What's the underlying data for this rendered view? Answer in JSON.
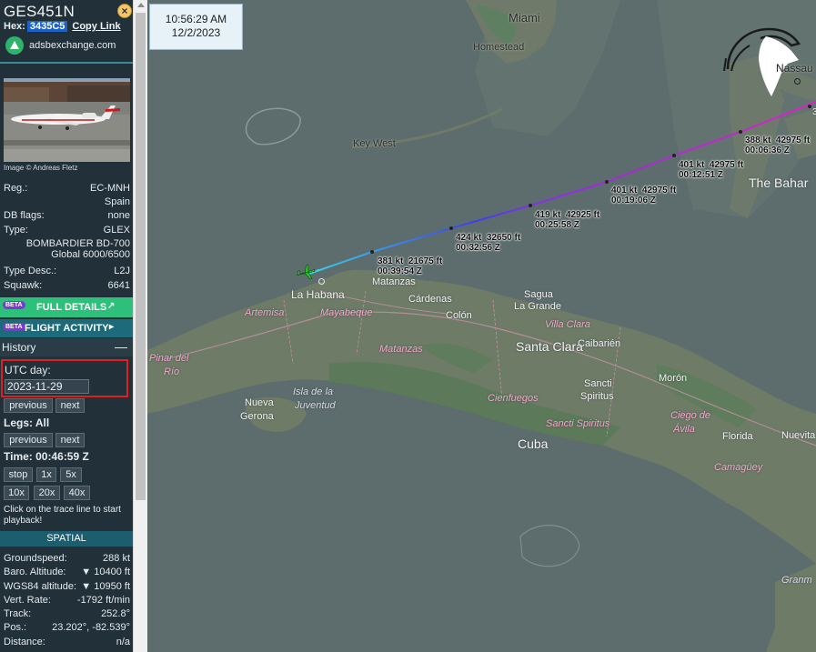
{
  "aircraft": {
    "callsign": "GES451N",
    "hex_label": "Hex:",
    "hex": "3435C5",
    "copy_link": "Copy Link",
    "brand": "adsbexchange.com",
    "image_credit": "Image © Andreas Fletz"
  },
  "details": {
    "reg_label": "Reg.:",
    "reg": "EC-MNH",
    "country": "Spain",
    "dbflags_label": "DB flags:",
    "dbflags": "none",
    "type_label": "Type:",
    "type": "GLEX",
    "model_line1": "BOMBARDIER BD-700",
    "model_line2": "Global 6000/6500",
    "typedesc_label": "Type Desc.:",
    "typedesc": "L2J",
    "squawk_label": "Squawk:",
    "squawk": "6641"
  },
  "buttons": {
    "beta": "BETA",
    "full_details": "FULL DETAILS",
    "flight_activity": "FLIGHT ACTIVITY"
  },
  "history": {
    "title": "History",
    "collapse": "—",
    "utc_label": "UTC day:",
    "utc_value": "2023-11-29",
    "previous": "previous",
    "next": "next",
    "legs_label": "Legs: All",
    "time_label": "Time: 00:46:59 Z",
    "stop": "stop",
    "s1x": "1x",
    "s5x": "5x",
    "s10x": "10x",
    "s20x": "20x",
    "s40x": "40x",
    "hint": "Click on the trace line to start playback!"
  },
  "spatial": {
    "title": "SPATIAL",
    "groundspeed_label": "Groundspeed:",
    "groundspeed": "288 kt",
    "baro_label": "Baro. Altitude:",
    "baro": "▼ 10400 ft",
    "wgs_label": "WGS84 altitude:",
    "wgs": "▼ 10950 ft",
    "vrate_label": "Vert. Rate:",
    "vrate": "-1792 ft/min",
    "track_label": "Track:",
    "track": "252.8°",
    "pos_label": "Pos.:",
    "pos": "23.202°, -82.539°",
    "distance_label": "Distance:",
    "distance": "n/a"
  },
  "clock": {
    "time": "10:56:29 AM",
    "date": "12/2/2023"
  },
  "map": {
    "labels": {
      "miami": "Miami",
      "homestead": "Homestead",
      "key_west": "Key West",
      "nassau": "Nassau",
      "bahamas": "The Bahar",
      "la_habana": "La Habana",
      "matanzas_city": "Matanzas",
      "cardenas": "Cárdenas",
      "sagua": "Sagua",
      "la_grande": "La Grande",
      "colon": "Colón",
      "villa_clara": "Villa Clara",
      "santa_clara": "Santa Clara",
      "caibarien": "Caibarién",
      "artemisa": "Artemisa",
      "mayabeque": "Mayabeque",
      "pinar1": "Pinar del",
      "pinar2": "Río",
      "matanzas_prov": "Matanzas",
      "moron": "Morón",
      "isla1": "Isla de la",
      "isla2": "Juventud",
      "nueva1": "Nueva",
      "nueva2": "Gerona",
      "cienfuegos": "Cienfuegos",
      "sancti1": "Sancti",
      "sancti2": "Spiritus",
      "sancti_prov": "Sancti Spiritus",
      "ciego1": "Ciego de",
      "ciego2": "Ávila",
      "florida": "Florida",
      "cuba": "Cuba",
      "camaguey": "Camagüey",
      "nuevita": "Nuevita",
      "granm": "Granm",
      "edge": "3"
    },
    "track_points": [
      {
        "speed": "381 kt",
        "alt": "21675 ft",
        "time": "00:39:54 Z"
      },
      {
        "speed": "424 kt",
        "alt": "32650 ft",
        "time": "00:32:56 Z"
      },
      {
        "speed": "419 kt",
        "alt": "42925 ft",
        "time": "00:25:58 Z"
      },
      {
        "speed": "401 kt",
        "alt": "42975 ft",
        "time": "00:19:06 Z"
      },
      {
        "speed": "401 kt",
        "alt": "42975 ft",
        "time": "00:12:51 Z"
      },
      {
        "speed": "388 kt",
        "alt": "42975 ft",
        "time": "00:06:36 Z"
      }
    ]
  },
  "colors": {
    "sidebar_bg": "#22303a",
    "accent_green": "#2cc07a",
    "accent_teal": "#1d6a7a",
    "hex_highlight": "#1b63c8",
    "selection_border": "#e02020",
    "track_start": "#3ed4e6",
    "track_mid": "#3a3ff0",
    "track_end": "#e020c8",
    "aircraft_icon": "#2ec22e"
  },
  "icons": {
    "close": "close-circle-icon",
    "brand": "adsbx-logo-icon",
    "external": "external-link-icon",
    "chevron": "chevron-right-icon",
    "aircraft": "airplane-icon",
    "logo": "eagle-logo-icon"
  }
}
